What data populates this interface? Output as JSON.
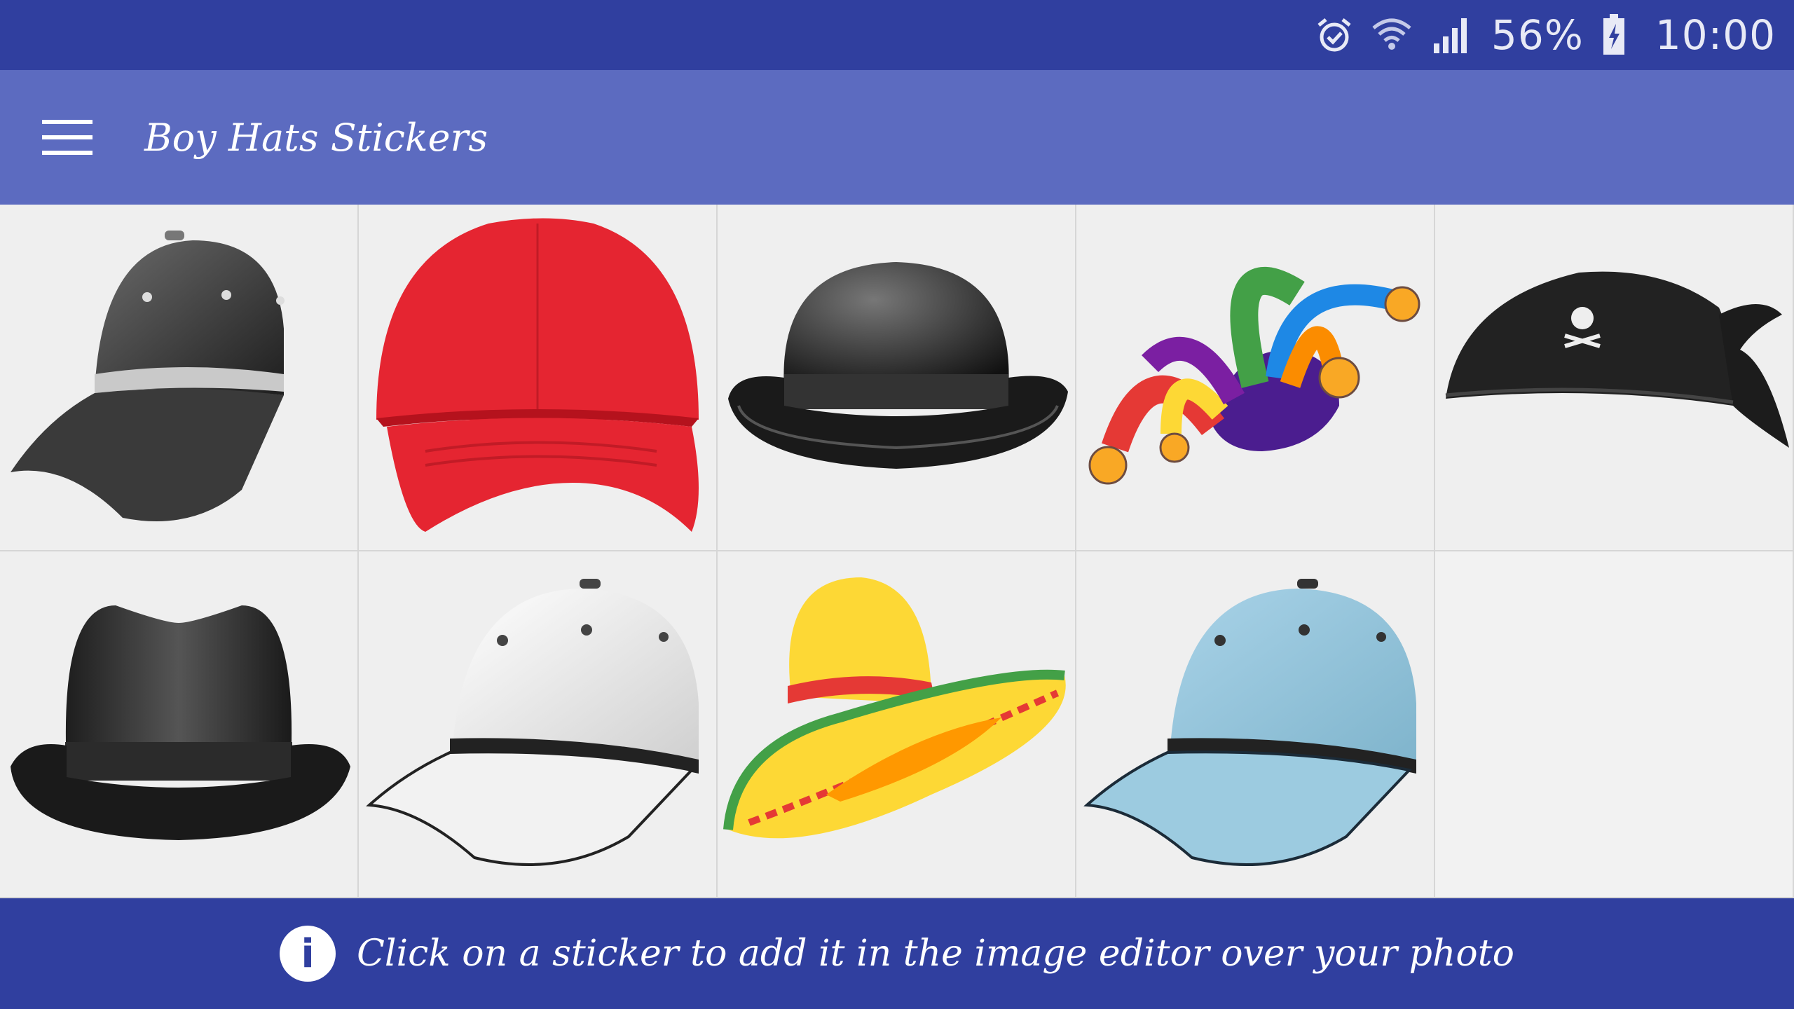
{
  "status_bar": {
    "battery_percent": "56%",
    "time": "10:00",
    "icons": [
      "alarm-icon",
      "wifi-icon",
      "signal-icon",
      "battery-charging-icon"
    ]
  },
  "app_bar": {
    "title": "Boy Hats Stickers",
    "menu_icon": "hamburger-menu-icon"
  },
  "stickers": [
    {
      "id": "black-baseball-cap"
    },
    {
      "id": "red-baseball-cap"
    },
    {
      "id": "black-bowler-hat"
    },
    {
      "id": "jester-hat"
    },
    {
      "id": "pirate-hat"
    },
    {
      "id": "black-fedora-hat"
    },
    {
      "id": "white-baseball-cap"
    },
    {
      "id": "sombrero-hat"
    },
    {
      "id": "light-blue-baseball-cap"
    }
  ],
  "bottom_bar": {
    "info_symbol": "i",
    "hint": "Click on a sticker to add it in the image editor over your photo"
  },
  "colors": {
    "status_bar": "#303f9f",
    "app_bar": "#5c6bc0",
    "grid_bg": "#efefef"
  }
}
